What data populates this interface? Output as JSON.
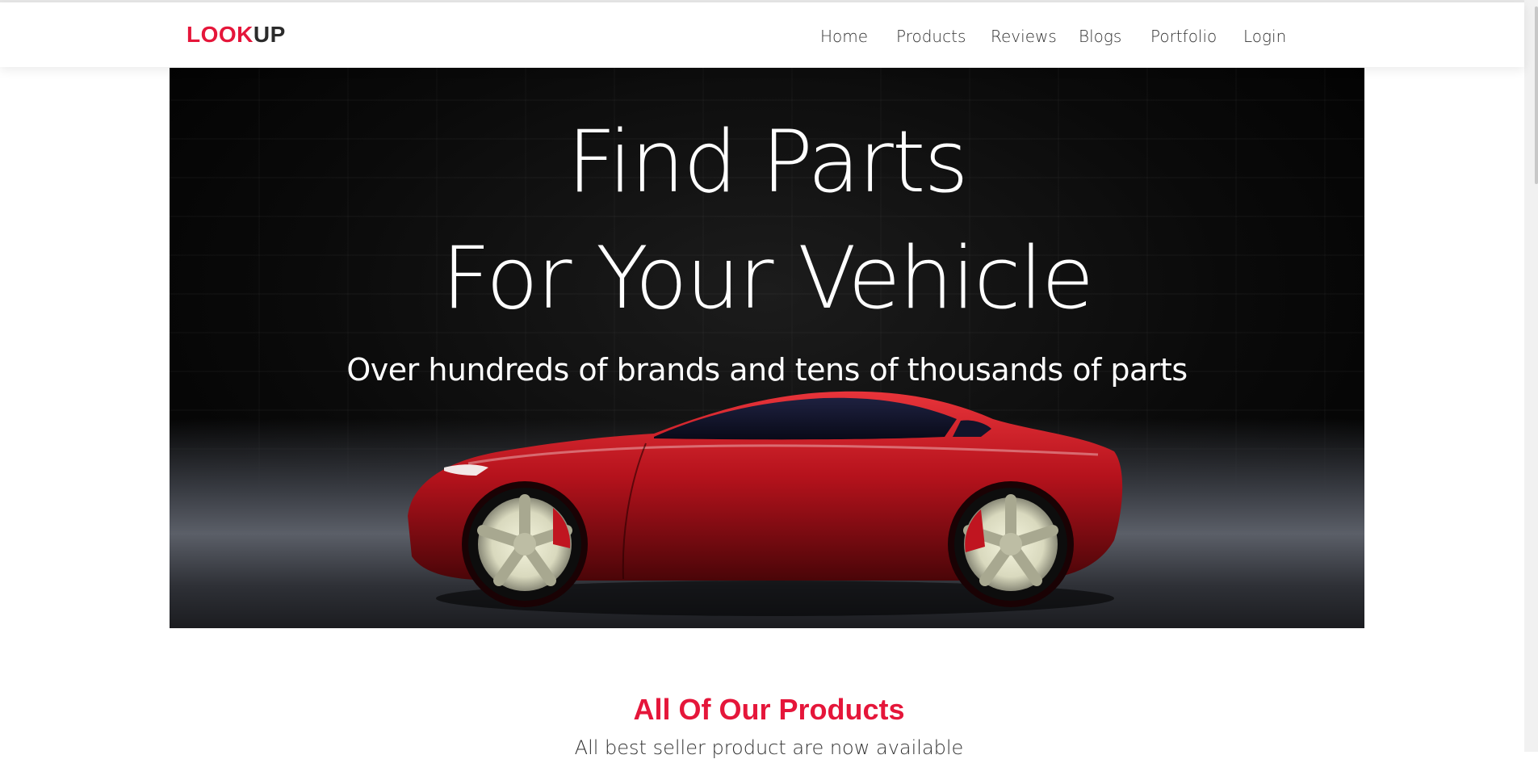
{
  "brand": {
    "part1": "LOOK",
    "part2": "UP",
    "accent_color": "#e5163a"
  },
  "nav": {
    "items": [
      {
        "label": "Home"
      },
      {
        "label": "Products"
      },
      {
        "label": "Reviews"
      },
      {
        "label": "Blogs"
      },
      {
        "label": "Portfolio"
      },
      {
        "label": "Login"
      }
    ]
  },
  "hero": {
    "title_line1": "Find Parts",
    "title_line2": "For Your Vehicle",
    "subtitle": "Over hundreds of brands and tens of thousands of parts",
    "image": "red-sports-car"
  },
  "products_section": {
    "title": "All Of Our Products",
    "subtitle": "All best seller product are now available"
  }
}
